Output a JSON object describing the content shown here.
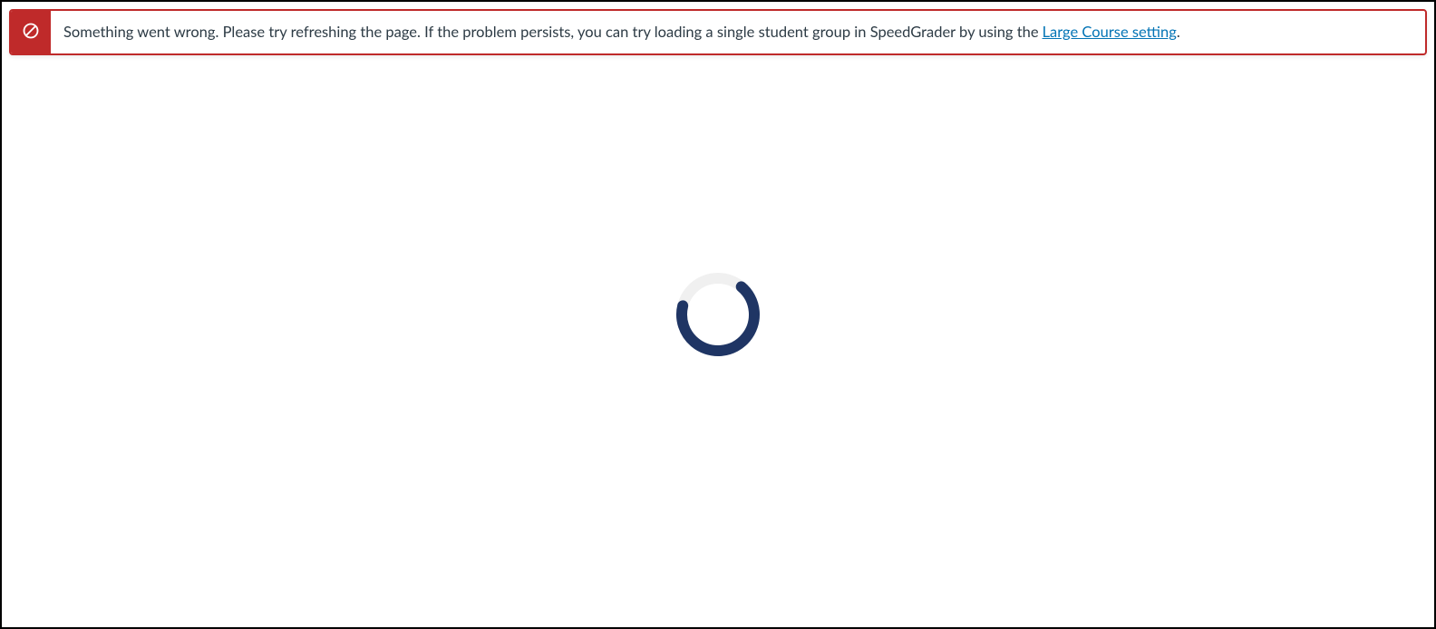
{
  "alert": {
    "message_before_link": "Something went wrong. Please try refreshing the page. If the problem persists, you can try loading a single student group in SpeedGrader by using the ",
    "link_text": "Large Course setting",
    "message_after_link": ".",
    "icon": "no-entry-icon",
    "border_color": "#bf2a2a",
    "icon_bg": "#bf2a2a"
  },
  "spinner": {
    "track_color": "#f0f0f0",
    "arc_color": "#1f3564"
  }
}
